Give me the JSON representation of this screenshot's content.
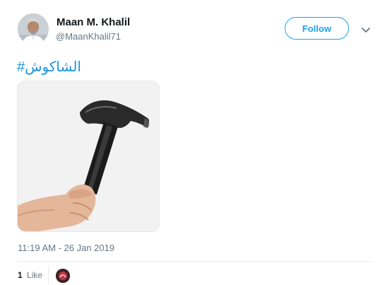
{
  "tweet": {
    "author": {
      "display_name": "Maan M. Khalil",
      "handle": "@MaanKhalil71",
      "avatar_icon": "profile-photo"
    },
    "follow_label": "Follow",
    "hashtag": "#الشاكوش",
    "media_icon": "hammer-in-hand-image",
    "timestamp": "11:19 AM - 26 Jan 2019",
    "likes": {
      "count": "1",
      "label": "Like"
    }
  },
  "colors": {
    "accent": "#1da1f2",
    "hashtag": "#1b95e0",
    "secondary_text": "#657786",
    "primary_text": "#14171a",
    "divider": "#e6ecf0"
  }
}
